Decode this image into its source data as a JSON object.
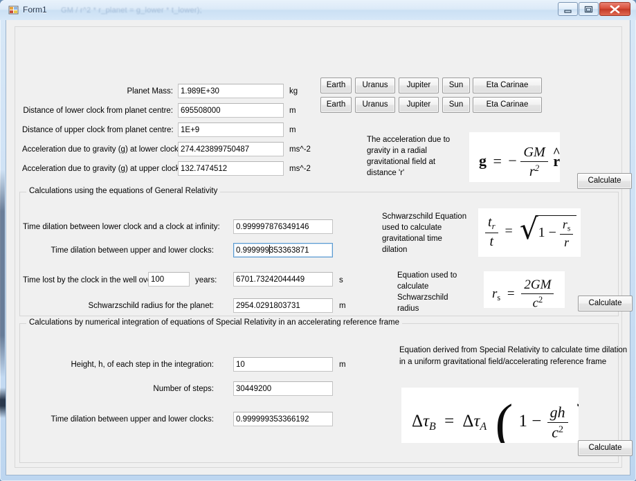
{
  "window": {
    "title": "Form1",
    "icon": "form-app-icon",
    "ghost_text": "GM / r^2 * r_planet  =  g_lower * t_lower);",
    "controls": {
      "minimize": "minimize-icon",
      "maximize": "maximize-icon",
      "close": "close-icon"
    },
    "colors": {
      "titlebar_accent": "#cbe0f4",
      "close_button": "#d9503c",
      "client_background": "#f0f0f0",
      "focus_border": "#5a9ad0"
    }
  },
  "top_section": {
    "rows": [
      {
        "label": "Planet Mass:",
        "value": "1.989E+30",
        "unit": "kg"
      },
      {
        "label": "Distance of lower clock from planet centre:",
        "value": "695508000",
        "unit": "m"
      },
      {
        "label": "Distance of upper clock from planet centre:",
        "value": "1E+9",
        "unit": "m"
      },
      {
        "label": "Acceleration due to gravity (g) at lower clock:",
        "value": "274.423899750487",
        "unit": "ms^-2"
      },
      {
        "label": "Acceleration due to gravity (g) at upper clock:",
        "value": "132.7474512",
        "unit": "ms^-2"
      }
    ],
    "preset_row_1": [
      "Earth",
      "Uranus",
      "Jupiter",
      "Sun",
      "Eta Carinae"
    ],
    "preset_row_2": [
      "Earth",
      "Uranus",
      "Jupiter",
      "Sun",
      "Eta Carinae"
    ],
    "description": "The acceleration due to gravity in a radial gravitational field at distance 'r'",
    "equation_alt": "g = -GM/r^2 * r-hat",
    "calculate_label": "Calculate"
  },
  "gr_section": {
    "title": "Calculations using the equations of General Relativity",
    "rows": [
      {
        "label": "Time dilation between lower clock and a clock at infinity:",
        "value": "0.999997876349146",
        "unit": ""
      },
      {
        "label": "Time dilation between upper and lower clocks:",
        "value": "0.999999353363871",
        "unit": "",
        "focused": true,
        "caret_after": 8
      },
      {
        "label": "Schwarzschild radius for the planet:",
        "value": "2954.0291803731",
        "unit": "m"
      }
    ],
    "time_lost": {
      "label_before": "Time lost by the clock in the well over",
      "years_value": "100",
      "label_after": "years:",
      "value": "6701.73242044449",
      "unit": "s"
    },
    "description_1": "Schwarzschild Equation used to calculate gravitational time dilation",
    "equation_1_alt": "t_r / t = sqrt(1 - r_s / r)",
    "description_2": "Equation used to calculate Schwarzschild radius",
    "equation_2_alt": "r_s = 2GM / c^2",
    "calculate_label": "Calculate"
  },
  "sr_section": {
    "title": "Calculations by numerical integration of equations of Special Relativity in an accelerating reference frame",
    "rows": [
      {
        "label": "Height, h, of each step in the integration:",
        "value": "10",
        "unit": "m"
      },
      {
        "label": "Number of steps:",
        "value": "30449200",
        "unit": ""
      },
      {
        "label": "Time dilation between upper and lower clocks:",
        "value": "0.999999353366192",
        "unit": ""
      }
    ],
    "description": "Equation derived from Special Relativity to calculate time dilation in a uniform gravitational field/accelerating reference frame",
    "equation_alt": "Delta tau_B = Delta tau_A ( 1 - gh / c^2 )",
    "calculate_label": "Calculate"
  }
}
